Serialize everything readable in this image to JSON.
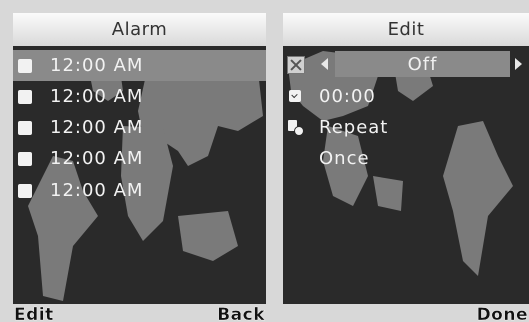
{
  "alarm_screen": {
    "title": "Alarm",
    "alarms": [
      {
        "time": "12:00 AM",
        "selected": true
      },
      {
        "time": "12:00 AM",
        "selected": false
      },
      {
        "time": "12:00 AM",
        "selected": false
      },
      {
        "time": "12:00 AM",
        "selected": false
      },
      {
        "time": "12:00 AM",
        "selected": false
      }
    ],
    "softkeys": {
      "left": "Edit",
      "right": "Back"
    }
  },
  "edit_screen": {
    "title": "Edit",
    "state_value": "Off",
    "time": "00:00",
    "repeat_label": "Repeat",
    "repeat_value": "Once",
    "softkeys": {
      "right": "Done"
    },
    "icons": {
      "state": "alarm-off-icon",
      "time": "clock-icon",
      "repeat": "repeat-icon"
    }
  },
  "colors": {
    "background": "#d8d8d8",
    "screen": "#2a2a2a",
    "selection": "#8a8a8a",
    "map_land": "#7a7a7a"
  }
}
